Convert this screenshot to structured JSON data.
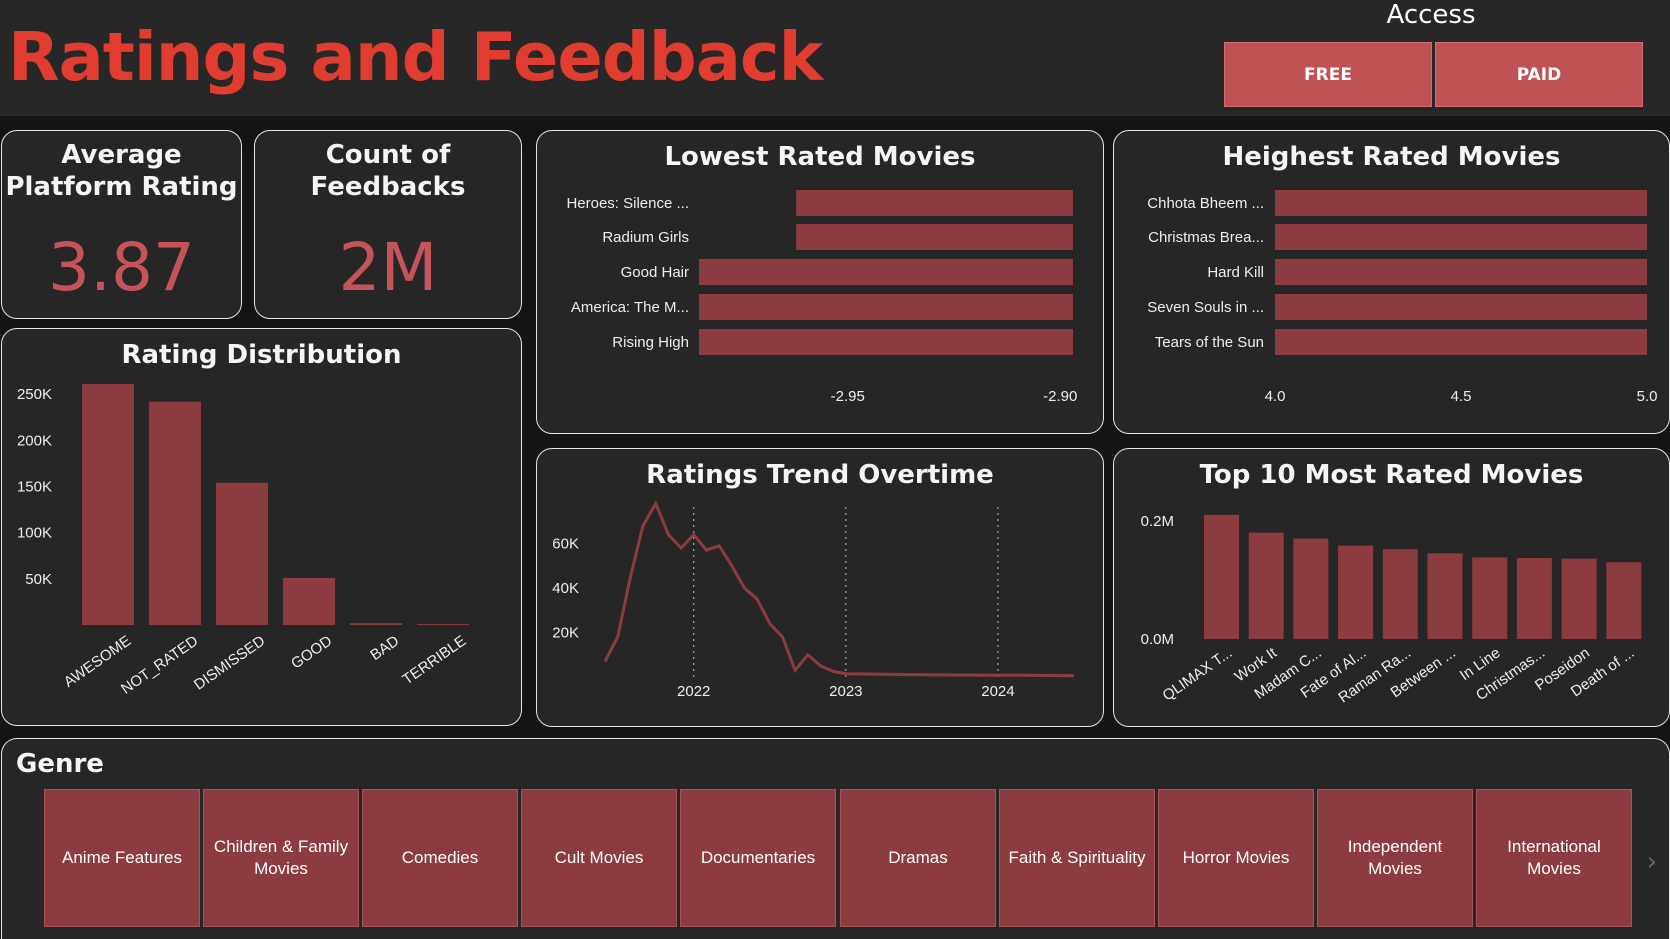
{
  "header": {
    "title": "Ratings and Feedback",
    "access_label": "Access",
    "access_buttons": [
      "FREE",
      "PAID"
    ]
  },
  "kpis": {
    "avg_rating": {
      "title_line1": "Average",
      "title_line2": "Platform Rating",
      "value": "3.87"
    },
    "feedback_count": {
      "title_line1": "Count of",
      "title_line2": "Feedbacks",
      "value": "2M"
    }
  },
  "colors": {
    "accent": "#e03c2f",
    "bar": "#8c3b40",
    "kpi": "#c5535a",
    "card": "#262626"
  },
  "chart_data": [
    {
      "id": "rating_distribution",
      "type": "bar",
      "title": "Rating Distribution",
      "categories": [
        "AWESOME",
        "NOT_RATED",
        "DISMISSED",
        "GOOD",
        "BAD",
        "TERRIBLE"
      ],
      "values": [
        261000,
        242000,
        154000,
        51000,
        2000,
        1000
      ],
      "yticks": [
        "250K",
        "200K",
        "150K",
        "100K",
        "50K"
      ],
      "ytick_values": [
        250000,
        200000,
        150000,
        100000,
        50000
      ],
      "ylim": [
        0,
        260000
      ]
    },
    {
      "id": "lowest_rated",
      "type": "bar",
      "orientation": "horizontal",
      "title": "Lowest Rated Movies",
      "categories": [
        "Heroes: Silence ...",
        "Radium Girls",
        "Good Hair",
        "America: The M...",
        "Rising High"
      ],
      "values": [
        -2.91,
        -2.91,
        -2.9,
        -2.9,
        -2.9
      ],
      "xticks": [
        "-2.95",
        "-2.90"
      ],
      "xtick_values": [
        -2.95,
        -2.9
      ],
      "xlim": [
        -2.985,
        -2.897
      ]
    },
    {
      "id": "highest_rated",
      "type": "bar",
      "orientation": "horizontal",
      "title": "Heighest Rated Movies",
      "categories": [
        "Chhota Bheem ...",
        "Christmas Brea...",
        "Hard Kill",
        "Seven Souls in ...",
        "Tears of the Sun"
      ],
      "values": [
        5.0,
        5.0,
        5.0,
        5.0,
        5.0
      ],
      "xticks": [
        "4.0",
        "4.5",
        "5.0"
      ],
      "xtick_values": [
        4.0,
        4.5,
        5.0
      ],
      "xlim": [
        4.0,
        5.0
      ]
    },
    {
      "id": "ratings_trend",
      "type": "line",
      "title": "Ratings Trend Overtime",
      "x": [
        "2021-06",
        "2021-07",
        "2021-08",
        "2021-09",
        "2021-10",
        "2021-11",
        "2021-12",
        "2022-01",
        "2022-02",
        "2022-03",
        "2022-04",
        "2022-05",
        "2022-06",
        "2022-07",
        "2022-08",
        "2022-09",
        "2022-10",
        "2022-11",
        "2022-12",
        "2023-01",
        "2023-04",
        "2023-07",
        "2023-10",
        "2024-01",
        "2024-04",
        "2024-07"
      ],
      "values": [
        7000,
        18000,
        45000,
        68000,
        78000,
        64000,
        58000,
        64000,
        57000,
        59000,
        50000,
        40000,
        35000,
        24000,
        18000,
        3000,
        10000,
        5000,
        2500,
        1500,
        1200,
        1000,
        900,
        800,
        700,
        600
      ],
      "xticks": [
        "2022",
        "2023",
        "2024"
      ],
      "yticks": [
        "60K",
        "40K",
        "20K"
      ],
      "ytick_values": [
        60000,
        40000,
        20000
      ],
      "ylim": [
        0,
        80000
      ]
    },
    {
      "id": "top10_most_rated",
      "type": "bar",
      "title": "Top 10 Most Rated Movies",
      "categories": [
        "QLIMAX T...",
        "Work It",
        "Madam C...",
        "Fate of Al...",
        "Raman Ra...",
        "Between ...",
        "In Line",
        "Christmas...",
        "Poseidon",
        "Death of ..."
      ],
      "values": [
        0.21,
        0.18,
        0.17,
        0.158,
        0.152,
        0.145,
        0.138,
        0.137,
        0.136,
        0.13
      ],
      "yticks": [
        "0.2M",
        "0.0M"
      ],
      "ytick_values": [
        0.2,
        0.0
      ],
      "ylim": [
        0,
        0.22
      ]
    }
  ],
  "genre": {
    "title": "Genre",
    "items": [
      "Anime Features",
      "Children & Family Movies",
      "Comedies",
      "Cult Movies",
      "Documentaries",
      "Dramas",
      "Faith & Spirituality",
      "Horror Movies",
      "Independent Movies",
      "International Movies"
    ]
  }
}
